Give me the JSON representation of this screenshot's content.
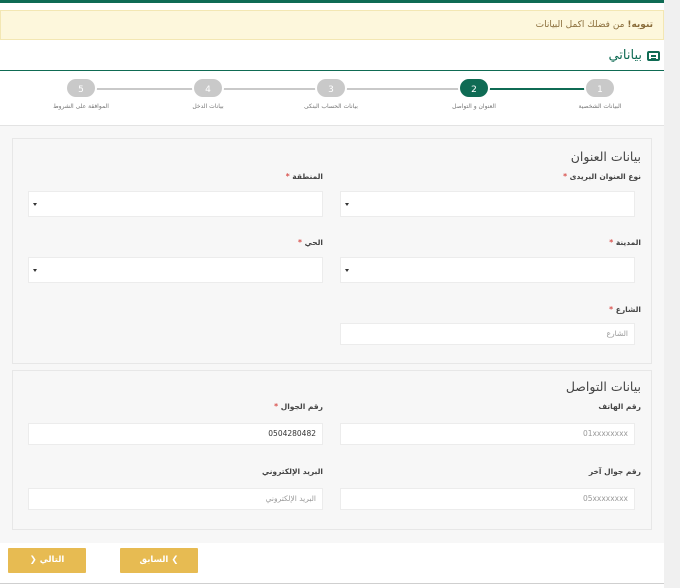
{
  "alert": {
    "strong": "تنويه!",
    "text": " من فضلك اكمل البيانات"
  },
  "page": {
    "title": "بياناتي"
  },
  "steps": [
    {
      "num": "1",
      "label": "البيانات الشخصية",
      "active": false
    },
    {
      "num": "2",
      "label": "العنوان و التواصل",
      "active": true
    },
    {
      "num": "3",
      "label": "بيانات الحساب البنكى",
      "active": false
    },
    {
      "num": "4",
      "label": "بيانات الدخل",
      "active": false
    },
    {
      "num": "5",
      "label": "الموافقة على الشروط",
      "active": false
    }
  ],
  "address": {
    "title": "بيانات العنوان",
    "postal_type_label": "نوع العنوان البريدى",
    "region_label": "المنطقة",
    "city_label": "المدينة",
    "district_label": "الحي",
    "street_label": "الشارع",
    "street_placeholder": "الشارع"
  },
  "contact": {
    "title": "بيانات التواصل",
    "phone_label": "رقم الهاتف",
    "phone_placeholder": "01xxxxxxxx",
    "mobile_label": "رقم الجوال",
    "mobile_value": "0504280482",
    "other_mobile_label": "رقم جوال آخر",
    "other_mobile_placeholder": "05xxxxxxxx",
    "email_label": "البريد الإلكتروني",
    "email_placeholder": "البريد الإلكتروني"
  },
  "buttons": {
    "next_label": "التالي",
    "prev_label": "السابق"
  },
  "colors": {
    "primary": "#0f6b54",
    "accent": "#e7bb52",
    "required": "#d9534f"
  }
}
